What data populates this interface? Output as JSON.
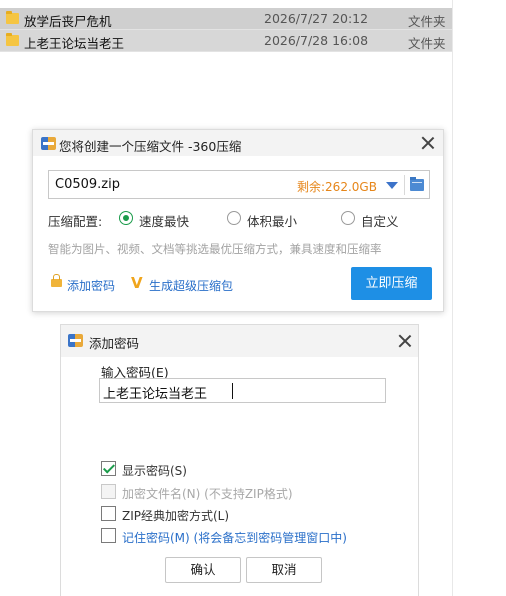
{
  "files": [
    {
      "name": "放学后丧尸危机",
      "date": "2026/7/27 20:12",
      "type": "文件夹"
    },
    {
      "name": "上老王论坛当老王",
      "date": "2026/7/28 16:08",
      "type": "文件夹"
    }
  ],
  "compress_dialog": {
    "title": "您将创建一个压缩文件 -360压缩",
    "filename": "C0509.zip",
    "remaining": "剩余:262.0GB",
    "config_label": "压缩配置:",
    "options": [
      {
        "label": "速度最快",
        "selected": true
      },
      {
        "label": "体积最小",
        "selected": false
      },
      {
        "label": "自定义",
        "selected": false
      }
    ],
    "hint": "智能为图片、视频、文档等挑选最优压缩方式，兼具速度和压缩率",
    "add_password_link": "添加密码",
    "super_pack_link": "生成超级压缩包",
    "compress_button": "立即压缩"
  },
  "password_dialog": {
    "title": "添加密码",
    "input_label": "输入密码(E)",
    "password_value": "上老王论坛当老王",
    "checkboxes": [
      {
        "label": "显示密码(S)",
        "checked": true,
        "disabled": false
      },
      {
        "label": "加密文件名(N) (不支持ZIP格式)",
        "checked": false,
        "disabled": true
      },
      {
        "label": "ZIP经典加密方式(L)",
        "checked": false,
        "disabled": false
      },
      {
        "label": "记住密码(M) (将会备忘到密码管理窗口中)",
        "checked": false,
        "disabled": false
      }
    ],
    "ok_button": "确认",
    "cancel_button": "取消"
  },
  "colors": {
    "accent_blue": "#1e8fe5",
    "link_blue": "#2a6fc9",
    "remaining_orange": "#e6861a",
    "check_green": "#1a9b4a"
  },
  "icons": [
    "folder-icon",
    "app-icon",
    "close-icon",
    "dropdown-arrow-icon",
    "browse-folder-icon",
    "lock-icon",
    "v-icon"
  ]
}
